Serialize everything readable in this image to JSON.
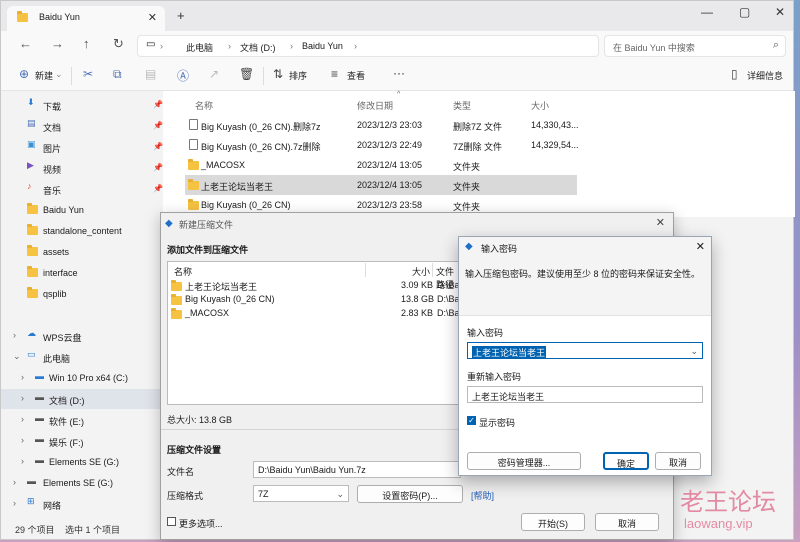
{
  "explorer": {
    "tab_title": "Baidu Yun",
    "breadcrumb": [
      "此电脑",
      "文档 (D:)",
      "Baidu Yun"
    ],
    "search_placeholder": "在 Baidu Yun 中搜索",
    "commands": {
      "new": "新建",
      "sort": "排序",
      "view": "查看",
      "details": "详细信息"
    },
    "quick_access": [
      {
        "label": "下载"
      },
      {
        "label": "文档"
      },
      {
        "label": "图片"
      },
      {
        "label": "视频"
      },
      {
        "label": "音乐"
      },
      {
        "label": "Baidu Yun"
      },
      {
        "label": "standalone_content"
      },
      {
        "label": "assets"
      },
      {
        "label": "interface"
      },
      {
        "label": "qsplib"
      }
    ],
    "tree": [
      {
        "label": "WPS云盘"
      },
      {
        "label": "此电脑"
      },
      {
        "label": "Win 10 Pro x64 (C:)"
      },
      {
        "label": "文档 (D:)"
      },
      {
        "label": "软件 (E:)"
      },
      {
        "label": "娱乐 (F:)"
      },
      {
        "label": "Elements SE (G:)"
      },
      {
        "label": "Elements SE (G:)"
      },
      {
        "label": "网络"
      }
    ],
    "status_count": "29 个项目",
    "status_selected": "选中 1 个项目",
    "columns": {
      "name": "名称",
      "date": "修改日期",
      "type": "类型",
      "size": "大小"
    },
    "files": [
      {
        "name": "Big Kuyash (0_26 CN).删除7z",
        "date": "2023/12/3 23:03",
        "type": "删除7Z 文件",
        "size": "14,330,43..."
      },
      {
        "name": "Big Kuyash (0_26 CN).7z删除",
        "date": "2023/12/3 22:49",
        "type": "7Z删除 文件",
        "size": "14,329,54..."
      },
      {
        "name": "_MACOSX",
        "date": "2023/12/4 13:05",
        "type": "文件夹",
        "size": ""
      },
      {
        "name": "上老王论坛当老王",
        "date": "2023/12/4 13:05",
        "type": "文件夹",
        "size": ""
      },
      {
        "name": "Big Kuyash (0_26 CN)",
        "date": "2023/12/3 23:58",
        "type": "文件夹",
        "size": ""
      }
    ]
  },
  "compress_dialog": {
    "title": "新建压缩文件",
    "section_add": "添加文件到压缩文件",
    "columns": {
      "name": "名称",
      "size": "大小",
      "path": "文件路径"
    },
    "items": [
      {
        "name": "上老王论坛当老王",
        "size": "3.09 KB",
        "path": "D:\\Bai"
      },
      {
        "name": "Big Kuyash (0_26 CN)",
        "size": "13.8 GB",
        "path": "D:\\Bai"
      },
      {
        "name": "_MACOSX",
        "size": "2.83 KB",
        "path": "D:\\Bai"
      }
    ],
    "total": "总大小: 13.8 GB",
    "section_settings": "压缩文件设置",
    "filename_label": "文件名",
    "filename_value": "D:\\Baidu Yun\\Baidu Yun.7z",
    "format_label": "压缩格式",
    "format_value": "7Z",
    "set_password": "设置密码(P)...",
    "help": "[帮助]",
    "more_options": "更多选项...",
    "start": "开始(S)",
    "cancel": "取消"
  },
  "password_dialog": {
    "title": "输入密码",
    "hint": "输入压缩包密码。建议使用至少 8 位的密码来保证安全性。",
    "password_label": "输入密码",
    "password_value": "上老王论坛当老王",
    "confirm_label": "重新输入密码",
    "confirm_value": "上老王论坛当老王",
    "show_password": "显示密码",
    "manager": "密码管理器...",
    "ok": "确定",
    "cancel": "取消"
  },
  "watermark": {
    "cn": "老王论坛",
    "en": "laowang.vip"
  }
}
